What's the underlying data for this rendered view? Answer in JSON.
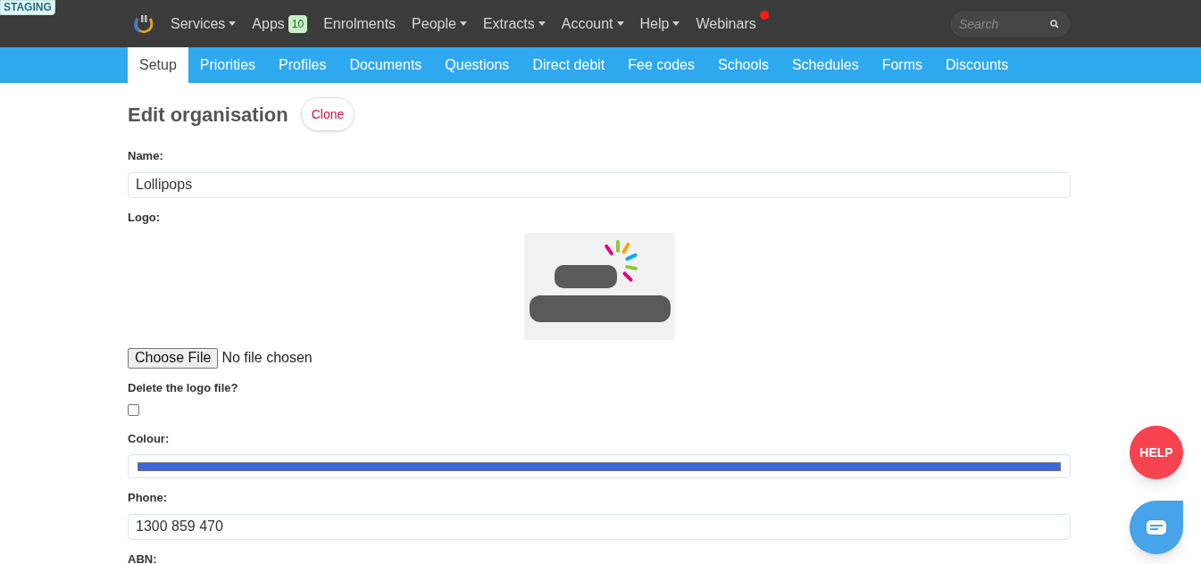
{
  "environment_badge": "STAGING",
  "top_nav": [
    {
      "label": "Services",
      "dropdown": true
    },
    {
      "label": "Apps",
      "badge": "10"
    },
    {
      "label": "Enrolments"
    },
    {
      "label": "People",
      "dropdown": true
    },
    {
      "label": "Extracts",
      "dropdown": true
    },
    {
      "label": "Account",
      "dropdown": true
    },
    {
      "label": "Help",
      "dropdown": true
    },
    {
      "label": "Webinars",
      "notification": true
    }
  ],
  "search": {
    "placeholder": "Search"
  },
  "tabs": [
    {
      "label": "Setup",
      "selected": true
    },
    {
      "label": "Priorities",
      "selected": false
    },
    {
      "label": "Profiles",
      "selected": false
    },
    {
      "label": "Documents",
      "selected": false
    },
    {
      "label": "Questions",
      "selected": false
    },
    {
      "label": "Direct debit",
      "selected": false
    },
    {
      "label": "Fee codes",
      "selected": false
    },
    {
      "label": "Schools",
      "selected": false
    },
    {
      "label": "Schedules",
      "selected": false
    },
    {
      "label": "Forms",
      "selected": false
    },
    {
      "label": "Discounts",
      "selected": false
    }
  ],
  "page_title": "Edit organisation",
  "clone_button": "Clone",
  "form": [
    {
      "kind": "text",
      "label": "Name:",
      "value": "Lollipops"
    },
    {
      "kind": "logo",
      "label": "Logo:",
      "file_button": "Choose File",
      "file_status": "No file chosen"
    },
    {
      "kind": "checkbox",
      "label": "Delete the logo file?",
      "checked": false
    },
    {
      "kind": "colour",
      "label": "Colour:",
      "color": "#3d66db"
    },
    {
      "kind": "text",
      "label": "Phone:",
      "value": "1300 859 470"
    },
    {
      "kind": "label",
      "label": "ABN:"
    }
  ],
  "help_button": "HELP"
}
